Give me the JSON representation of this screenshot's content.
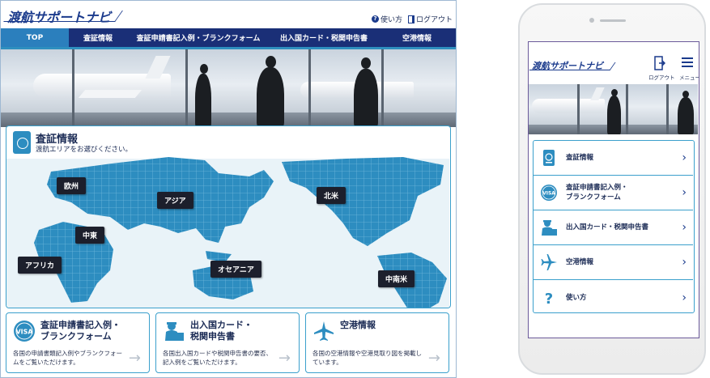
{
  "brand": {
    "logo_text": "渡航サポートナビ"
  },
  "desktop": {
    "header": {
      "help_label": "使い方",
      "logout_label": "ログアウト"
    },
    "nav": [
      {
        "label": "TOP"
      },
      {
        "label": "査証情報"
      },
      {
        "label": "査証申請書記入例・ブランクフォーム"
      },
      {
        "label": "出入国カード・税関申告書"
      },
      {
        "label": "空港情報"
      }
    ],
    "map_panel": {
      "title": "査証情報",
      "subtitle": "渡航エリアをお選びください。",
      "regions": [
        {
          "label": "欧州"
        },
        {
          "label": "アジア"
        },
        {
          "label": "北米"
        },
        {
          "label": "中東"
        },
        {
          "label": "アフリカ"
        },
        {
          "label": "オセアニア"
        },
        {
          "label": "中南米"
        }
      ]
    },
    "cards": [
      {
        "title_line1": "査証申請書記入例・",
        "title_line2": "ブランクフォーム",
        "desc": "各国の申請書類記入例やブランクフォームをご覧いただけます。",
        "icon": "visa-icon"
      },
      {
        "title_line1": "出入国カード・",
        "title_line2": "税関申告書",
        "desc": "各国出入国カードや税関申告書の要否、記入例をご覧いただけます。",
        "icon": "immigration-officer-icon"
      },
      {
        "title_line1": "空港情報",
        "title_line2": "",
        "desc": "各国の空港情報や空港見取り図を掲載しています。",
        "icon": "airplane-icon"
      }
    ],
    "arrow_glyph": "→"
  },
  "phone": {
    "logout_label": "ログアウト",
    "menu_label": "メニュー",
    "items": [
      {
        "line1": "査証情報",
        "line2": "",
        "icon": "passport-icon"
      },
      {
        "line1": "査証申請書記入例・",
        "line2": "ブランクフォーム",
        "icon": "visa-icon"
      },
      {
        "line1": "出入国カード・税関申告書",
        "line2": "",
        "icon": "immigration-officer-icon"
      },
      {
        "line1": "空港情報",
        "line2": "",
        "icon": "airplane-icon"
      },
      {
        "line1": "使い方",
        "line2": "",
        "icon": "question-icon"
      }
    ],
    "chevron_glyph": "›"
  },
  "colors": {
    "navy": "#1a2f77",
    "accent": "#2b7fbd",
    "map_land": "#2d8dc0",
    "region_button": "#1c1f2c"
  }
}
